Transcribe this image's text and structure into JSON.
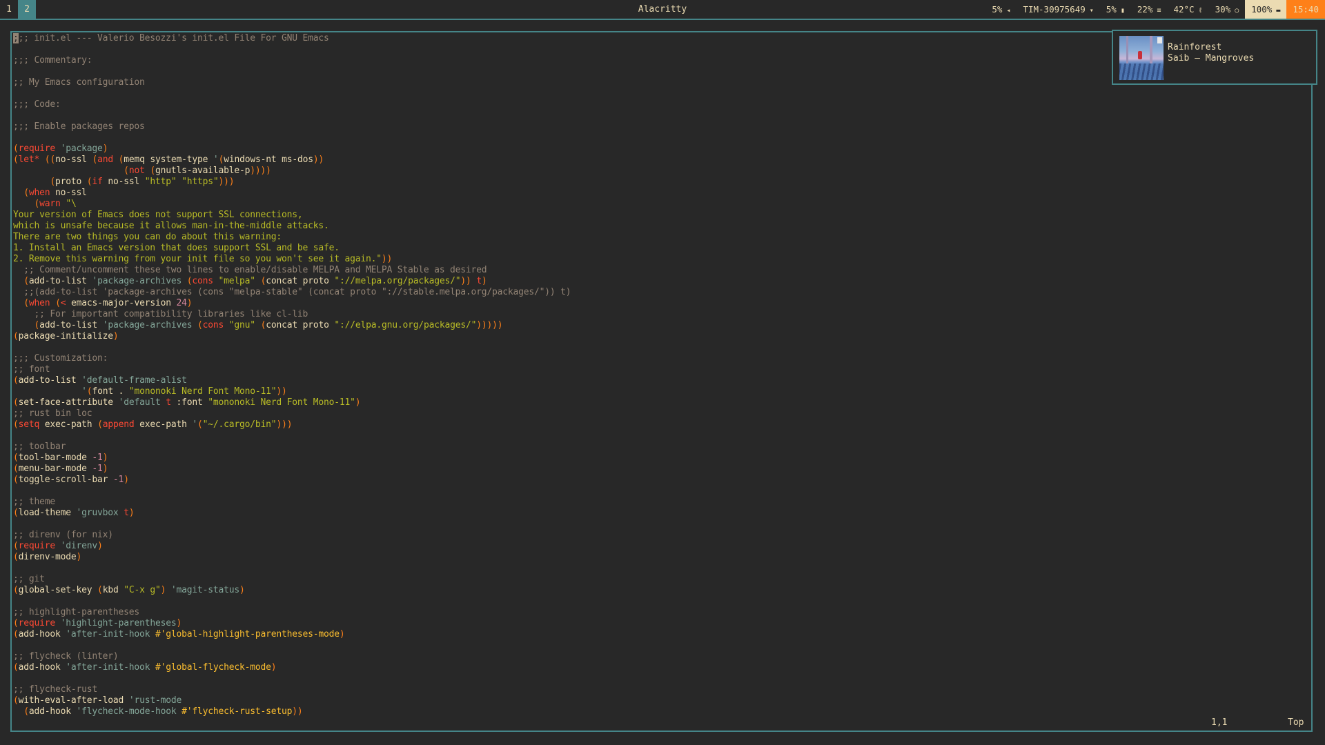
{
  "topbar": {
    "workspaces": [
      {
        "label": "1",
        "active": false
      },
      {
        "label": "2",
        "active": true
      }
    ],
    "title": "Alacritty",
    "status": [
      {
        "name": "volume",
        "value": "5%",
        "icon": "◂"
      },
      {
        "name": "wifi",
        "value": "TIM-30975649",
        "icon": "▾"
      },
      {
        "name": "battery",
        "value": "5%",
        "icon": "▮"
      },
      {
        "name": "cpu",
        "value": "22%",
        "icon": "≡"
      },
      {
        "name": "temperature",
        "value": "42°C",
        "icon": "🌡"
      },
      {
        "name": "memory",
        "value": "30%",
        "icon": "○"
      },
      {
        "name": "brightness",
        "value": "100%",
        "icon": "▬"
      },
      {
        "name": "clock",
        "value": "15:40"
      }
    ]
  },
  "notification": {
    "title": "Rainforest",
    "body": "Saib – Mangroves",
    "icon": "album-art"
  },
  "editor": {
    "cursor_char": ";",
    "lines": [
      [
        [
          "c",
          ";;; init.el --- Valerio Besozzi's init.el File For GNU Emacs"
        ]
      ],
      [],
      [
        [
          "c",
          ";;; Commentary:"
        ]
      ],
      [],
      [
        [
          "c",
          ";; My Emacs configuration"
        ]
      ],
      [],
      [
        [
          "c",
          ";;; Code:"
        ]
      ],
      [],
      [
        [
          "c",
          ";;; Enable packages repos"
        ]
      ],
      [],
      [
        [
          "p",
          "("
        ],
        [
          "k",
          "require"
        ],
        [
          "t",
          " "
        ],
        [
          "q",
          "'package"
        ],
        [
          "p",
          ")"
        ]
      ],
      [
        [
          "p",
          "("
        ],
        [
          "k",
          "let*"
        ],
        [
          "t",
          " "
        ],
        [
          "p",
          "(("
        ],
        [
          "t",
          "no-ssl "
        ],
        [
          "p",
          "("
        ],
        [
          "k",
          "and"
        ],
        [
          "t",
          " "
        ],
        [
          "p",
          "("
        ],
        [
          "t",
          "memq system-type "
        ],
        [
          "q",
          "'"
        ],
        [
          "p",
          "("
        ],
        [
          "t",
          "windows-nt ms-dos"
        ],
        [
          "p",
          "))"
        ]
      ],
      [
        [
          "t",
          "                     "
        ],
        [
          "p",
          "("
        ],
        [
          "k",
          "not"
        ],
        [
          "t",
          " "
        ],
        [
          "p",
          "("
        ],
        [
          "t",
          "gnutls-available-p"
        ],
        [
          "p",
          "))))"
        ]
      ],
      [
        [
          "t",
          "       "
        ],
        [
          "p",
          "("
        ],
        [
          "t",
          "proto "
        ],
        [
          "p",
          "("
        ],
        [
          "k",
          "if"
        ],
        [
          "t",
          " no-ssl "
        ],
        [
          "s",
          "\"http\" \"https\""
        ],
        [
          "p",
          ")))"
        ]
      ],
      [
        [
          "t",
          "  "
        ],
        [
          "p",
          "("
        ],
        [
          "k",
          "when"
        ],
        [
          "t",
          " no-ssl"
        ]
      ],
      [
        [
          "t",
          "    "
        ],
        [
          "p",
          "("
        ],
        [
          "k",
          "warn"
        ],
        [
          "t",
          " "
        ],
        [
          "s",
          "\"\\"
        ]
      ],
      [
        [
          "s",
          "Your version of Emacs does not support SSL connections,"
        ]
      ],
      [
        [
          "s",
          "which is unsafe because it allows man-in-the-middle attacks."
        ]
      ],
      [
        [
          "s",
          "There are two things you can do about this warning:"
        ]
      ],
      [
        [
          "s",
          "1. Install an Emacs version that does support SSL and be safe."
        ]
      ],
      [
        [
          "s",
          "2. Remove this warning from your init file so you won't see it again.\""
        ],
        [
          "p",
          "))"
        ]
      ],
      [
        [
          "t",
          "  "
        ],
        [
          "c",
          ";; Comment/uncomment these two lines to enable/disable MELPA and MELPA Stable as desired"
        ]
      ],
      [
        [
          "t",
          "  "
        ],
        [
          "p",
          "("
        ],
        [
          "t",
          "add-to-list "
        ],
        [
          "q",
          "'package-archives"
        ],
        [
          "t",
          " "
        ],
        [
          "p",
          "("
        ],
        [
          "k",
          "cons"
        ],
        [
          "t",
          " "
        ],
        [
          "s",
          "\"melpa\""
        ],
        [
          "t",
          " "
        ],
        [
          "p",
          "("
        ],
        [
          "t",
          "concat proto "
        ],
        [
          "s",
          "\"://melpa.org/packages/\""
        ],
        [
          "p",
          "))"
        ],
        [
          "t",
          " "
        ],
        [
          "k",
          "t"
        ],
        [
          "p",
          ")"
        ]
      ],
      [
        [
          "t",
          "  "
        ],
        [
          "c",
          ";;(add-to-list 'package-archives (cons \"melpa-stable\" (concat proto \"://stable.melpa.org/packages/\")) t)"
        ]
      ],
      [
        [
          "t",
          "  "
        ],
        [
          "p",
          "("
        ],
        [
          "k",
          "when"
        ],
        [
          "t",
          " "
        ],
        [
          "p",
          "("
        ],
        [
          "k",
          "<"
        ],
        [
          "t",
          " emacs-major-version "
        ],
        [
          "n",
          "24"
        ],
        [
          "p",
          ")"
        ]
      ],
      [
        [
          "t",
          "    "
        ],
        [
          "c",
          ";; For important compatibility libraries like cl-lib"
        ]
      ],
      [
        [
          "t",
          "    "
        ],
        [
          "p",
          "("
        ],
        [
          "t",
          "add-to-list "
        ],
        [
          "q",
          "'package-archives"
        ],
        [
          "t",
          " "
        ],
        [
          "p",
          "("
        ],
        [
          "k",
          "cons"
        ],
        [
          "t",
          " "
        ],
        [
          "s",
          "\"gnu\""
        ],
        [
          "t",
          " "
        ],
        [
          "p",
          "("
        ],
        [
          "t",
          "concat proto "
        ],
        [
          "s",
          "\"://elpa.gnu.org/packages/\""
        ],
        [
          "p",
          ")))))"
        ]
      ],
      [
        [
          "p",
          "("
        ],
        [
          "t",
          "package-initialize"
        ],
        [
          "p",
          ")"
        ]
      ],
      [],
      [
        [
          "c",
          ";;; Customization:"
        ]
      ],
      [
        [
          "c",
          ";; font"
        ]
      ],
      [
        [
          "p",
          "("
        ],
        [
          "t",
          "add-to-list "
        ],
        [
          "q",
          "'default-frame-alist"
        ]
      ],
      [
        [
          "t",
          "             "
        ],
        [
          "q",
          "'"
        ],
        [
          "p",
          "("
        ],
        [
          "t",
          "font . "
        ],
        [
          "s",
          "\"mononoki Nerd Font Mono-11\""
        ],
        [
          "p",
          "))"
        ]
      ],
      [
        [
          "p",
          "("
        ],
        [
          "t",
          "set-face-attribute "
        ],
        [
          "q",
          "'default"
        ],
        [
          "t",
          " "
        ],
        [
          "k",
          "t"
        ],
        [
          "t",
          " :font "
        ],
        [
          "s",
          "\"mononoki Nerd Font Mono-11\""
        ],
        [
          "p",
          ")"
        ]
      ],
      [
        [
          "c",
          ";; rust bin loc"
        ]
      ],
      [
        [
          "p",
          "("
        ],
        [
          "k",
          "setq"
        ],
        [
          "t",
          " exec-path "
        ],
        [
          "p",
          "("
        ],
        [
          "k",
          "append"
        ],
        [
          "t",
          " exec-path "
        ],
        [
          "q",
          "'"
        ],
        [
          "p",
          "("
        ],
        [
          "s",
          "\"~/.cargo/bin\""
        ],
        [
          "p",
          ")))"
        ]
      ],
      [],
      [
        [
          "c",
          ";; toolbar"
        ]
      ],
      [
        [
          "p",
          "("
        ],
        [
          "t",
          "tool-bar-mode "
        ],
        [
          "n",
          "-1"
        ],
        [
          "p",
          ")"
        ]
      ],
      [
        [
          "p",
          "("
        ],
        [
          "t",
          "menu-bar-mode "
        ],
        [
          "n",
          "-1"
        ],
        [
          "p",
          ")"
        ]
      ],
      [
        [
          "p",
          "("
        ],
        [
          "t",
          "toggle-scroll-bar "
        ],
        [
          "n",
          "-1"
        ],
        [
          "p",
          ")"
        ]
      ],
      [],
      [
        [
          "c",
          ";; theme"
        ]
      ],
      [
        [
          "p",
          "("
        ],
        [
          "t",
          "load-theme "
        ],
        [
          "q",
          "'gruvbox"
        ],
        [
          "t",
          " "
        ],
        [
          "k",
          "t"
        ],
        [
          "p",
          ")"
        ]
      ],
      [],
      [
        [
          "c",
          ";; direnv (for nix)"
        ]
      ],
      [
        [
          "p",
          "("
        ],
        [
          "k",
          "require"
        ],
        [
          "t",
          " "
        ],
        [
          "q",
          "'direnv"
        ],
        [
          "p",
          ")"
        ]
      ],
      [
        [
          "p",
          "("
        ],
        [
          "t",
          "direnv-mode"
        ],
        [
          "p",
          ")"
        ]
      ],
      [],
      [
        [
          "c",
          ";; git"
        ]
      ],
      [
        [
          "p",
          "("
        ],
        [
          "t",
          "global-set-key "
        ],
        [
          "p",
          "("
        ],
        [
          "t",
          "kbd "
        ],
        [
          "s",
          "\"C-x g\""
        ],
        [
          "p",
          ")"
        ],
        [
          "t",
          " "
        ],
        [
          "q",
          "'magit-status"
        ],
        [
          "p",
          ")"
        ]
      ],
      [],
      [
        [
          "c",
          ";; highlight-parentheses"
        ]
      ],
      [
        [
          "p",
          "("
        ],
        [
          "k",
          "require"
        ],
        [
          "t",
          " "
        ],
        [
          "q",
          "'highlight-parentheses"
        ],
        [
          "p",
          ")"
        ]
      ],
      [
        [
          "p",
          "("
        ],
        [
          "t",
          "add-hook "
        ],
        [
          "q",
          "'after-init-hook"
        ],
        [
          "t",
          " "
        ],
        [
          "f",
          "#'global-highlight-parentheses-mode"
        ],
        [
          "p",
          ")"
        ]
      ],
      [],
      [
        [
          "c",
          ";; flycheck (linter)"
        ]
      ],
      [
        [
          "p",
          "("
        ],
        [
          "t",
          "add-hook "
        ],
        [
          "q",
          "'after-init-hook"
        ],
        [
          "t",
          " "
        ],
        [
          "f",
          "#'global-flycheck-mode"
        ],
        [
          "p",
          ")"
        ]
      ],
      [],
      [
        [
          "c",
          ";; flycheck-rust"
        ]
      ],
      [
        [
          "p",
          "("
        ],
        [
          "t",
          "with-eval-after-load "
        ],
        [
          "q",
          "'rust-mode"
        ]
      ],
      [
        [
          "t",
          "  "
        ],
        [
          "p",
          "("
        ],
        [
          "t",
          "add-hook "
        ],
        [
          "q",
          "'flycheck-mode-hook"
        ],
        [
          "t",
          " "
        ],
        [
          "f",
          "#'flycheck-rust-setup"
        ],
        [
          "p",
          "))"
        ]
      ]
    ]
  },
  "modeline": {
    "position": "1,1",
    "scroll": "Top"
  }
}
